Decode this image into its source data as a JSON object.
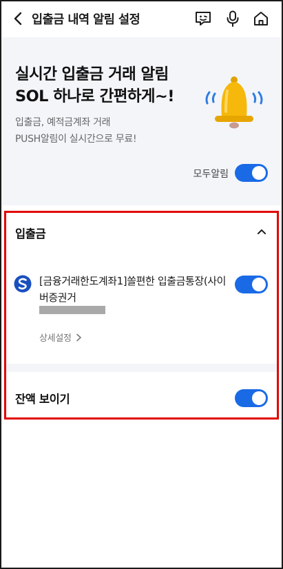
{
  "header": {
    "title": "입출금 내역 알림 설정"
  },
  "hero": {
    "title_line1": "실시간 입출금 거래 알림",
    "title_line2": "SOL 하나로 간편하게~!",
    "sub_line1": "입출금, 예적금계좌 거래",
    "sub_line2": "PUSH알림이 실시간으로 무료!",
    "all_alarm_label": "모두알림",
    "all_alarm_on": true
  },
  "deposit": {
    "section_title": "입출금",
    "account_name": "[금융거래한도계좌1]쏠편한 입출금통장(사이버증권거",
    "account_alarm_on": true,
    "detail_label": "상세설정"
  },
  "balance": {
    "label": "잔액 보이기",
    "on": true
  },
  "colors": {
    "accent": "#1a6ae6",
    "hero_bg": "#f3f5f9",
    "highlight_border": "#e20000",
    "bell": "#f5b80b"
  }
}
